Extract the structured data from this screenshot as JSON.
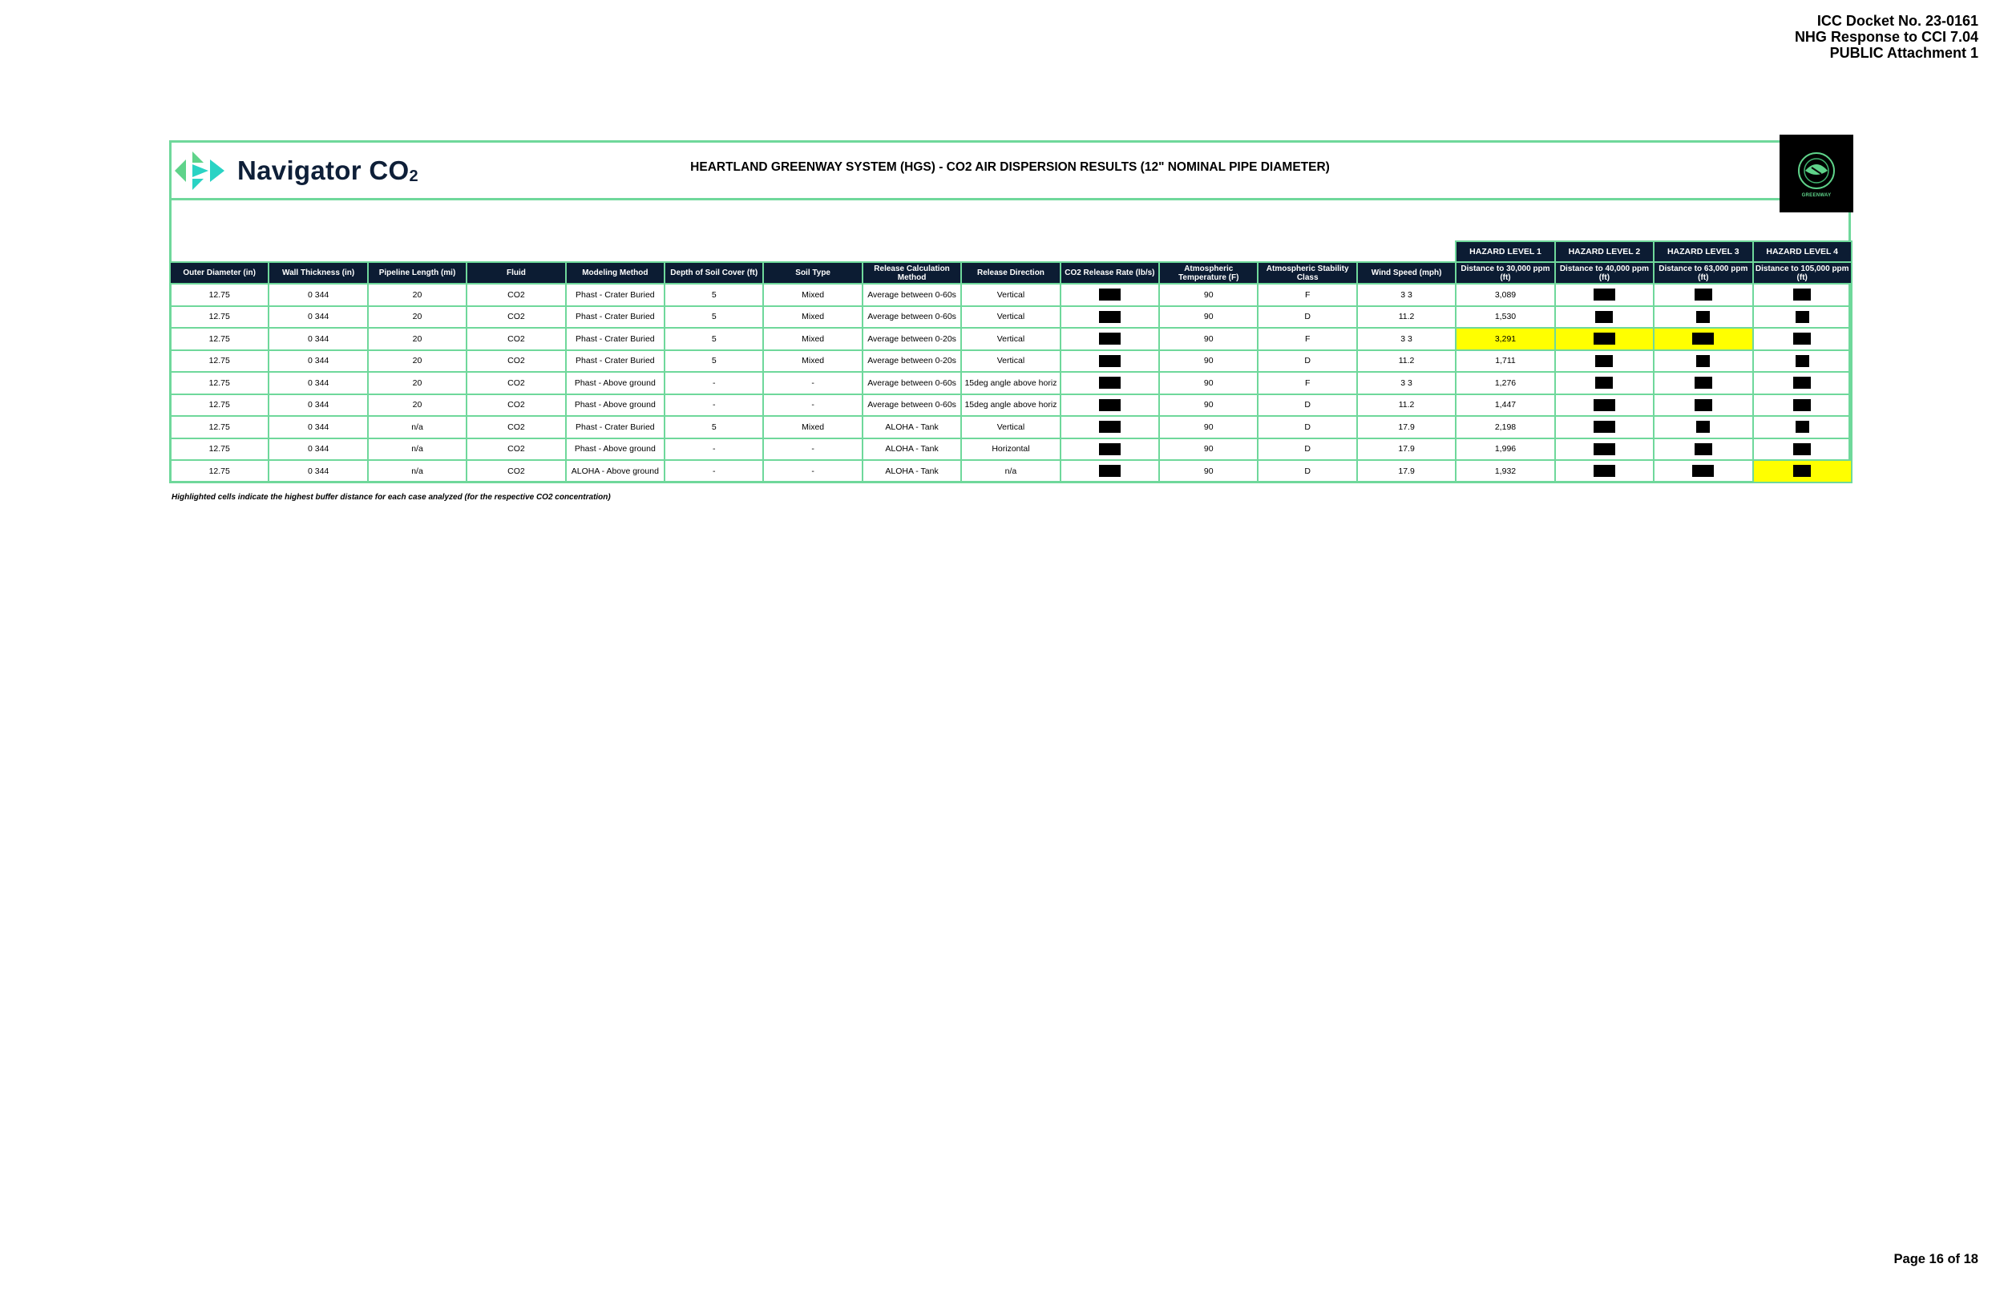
{
  "header": {
    "docket": "ICC Docket No. 23-0161",
    "response": "NHG Response to CCI 7.04",
    "attachment": "PUBLIC Attachment 1"
  },
  "logo": {
    "brand": "Navigator CO",
    "subscript": "2",
    "icon": "navigator-chevrons-icon"
  },
  "corner_logo": {
    "icon": "heartland-greenway-globe-icon",
    "text": "GREENWAY"
  },
  "title": "HEARTLAND GREENWAY SYSTEM (HGS) - CO2 AIR DISPERSION RESULTS (12\" NOMINAL PIPE DIAMETER)",
  "hazard_levels": [
    "HAZARD LEVEL 1",
    "HAZARD LEVEL 2",
    "HAZARD LEVEL 3",
    "HAZARD LEVEL 4"
  ],
  "columns": [
    "Outer Diameter (in)",
    "Wall Thickness (in)",
    "Pipeline Length (mi)",
    "Fluid",
    "Modeling Method",
    "Depth of Soil Cover (ft)",
    "Soil Type",
    "Release Calculation Method",
    "Release Direction",
    "CO2 Release Rate (lb/s)",
    "Atmospheric Temperature (F)",
    "Atmospheric Stability Class",
    "Wind Speed (mph)",
    "Distance to 30,000 ppm (ft)",
    "Distance to 40,000 ppm (ft)",
    "Distance to 63,000 ppm (ft)",
    "Distance to 105,000 ppm (ft)"
  ],
  "rows": [
    {
      "od": "12.75",
      "wt": "0 344",
      "len": "20",
      "fluid": "CO2",
      "method": "Phast - Crater Buried",
      "depth": "5",
      "soil": "Mixed",
      "calc": "Average between 0-60s",
      "dir": "Vertical",
      "temp": "90",
      "stab": "F",
      "wind": "3 3",
      "d30": "3,089",
      "r": [
        "wide",
        "wide",
        "mid",
        "mid"
      ],
      "hl": [
        false,
        false,
        false,
        false
      ]
    },
    {
      "od": "12.75",
      "wt": "0 344",
      "len": "20",
      "fluid": "CO2",
      "method": "Phast - Crater Buried",
      "depth": "5",
      "soil": "Mixed",
      "calc": "Average between 0-60s",
      "dir": "Vertical",
      "temp": "90",
      "stab": "D",
      "wind": "11.2",
      "d30": "1,530",
      "r": [
        "wide",
        "mid",
        "sm",
        "sm"
      ],
      "hl": [
        false,
        false,
        false,
        false
      ]
    },
    {
      "od": "12.75",
      "wt": "0 344",
      "len": "20",
      "fluid": "CO2",
      "method": "Phast - Crater Buried",
      "depth": "5",
      "soil": "Mixed",
      "calc": "Average between 0-20s",
      "dir": "Vertical",
      "temp": "90",
      "stab": "F",
      "wind": "3 3",
      "d30": "3,291",
      "r": [
        "wide",
        "wide",
        "wide",
        "mid"
      ],
      "hl": [
        true,
        true,
        true,
        false
      ]
    },
    {
      "od": "12.75",
      "wt": "0 344",
      "len": "20",
      "fluid": "CO2",
      "method": "Phast - Crater Buried",
      "depth": "5",
      "soil": "Mixed",
      "calc": "Average between 0-20s",
      "dir": "Vertical",
      "temp": "90",
      "stab": "D",
      "wind": "11.2",
      "d30": "1,711",
      "r": [
        "wide",
        "mid",
        "sm",
        "sm"
      ],
      "hl": [
        false,
        false,
        false,
        false
      ]
    },
    {
      "od": "12.75",
      "wt": "0 344",
      "len": "20",
      "fluid": "CO2",
      "method": "Phast - Above ground",
      "depth": "-",
      "soil": "-",
      "calc": "Average between 0-60s",
      "dir": "15deg angle above horiz",
      "temp": "90",
      "stab": "F",
      "wind": "3 3",
      "d30": "1,276",
      "r": [
        "wide",
        "mid",
        "mid",
        "mid"
      ],
      "hl": [
        false,
        false,
        false,
        false
      ]
    },
    {
      "od": "12.75",
      "wt": "0 344",
      "len": "20",
      "fluid": "CO2",
      "method": "Phast - Above ground",
      "depth": "-",
      "soil": "-",
      "calc": "Average between 0-60s",
      "dir": "15deg angle above horiz",
      "temp": "90",
      "stab": "D",
      "wind": "11.2",
      "d30": "1,447",
      "r": [
        "wide",
        "wide",
        "mid",
        "mid"
      ],
      "hl": [
        false,
        false,
        false,
        false
      ]
    },
    {
      "od": "12.75",
      "wt": "0 344",
      "len": "n/a",
      "fluid": "CO2",
      "method": "Phast - Crater Buried",
      "depth": "5",
      "soil": "Mixed",
      "calc": "ALOHA - Tank",
      "dir": "Vertical",
      "temp": "90",
      "stab": "D",
      "wind": "17.9",
      "d30": "2,198",
      "r": [
        "wide",
        "wide",
        "sm",
        "sm"
      ],
      "hl": [
        false,
        false,
        false,
        false
      ]
    },
    {
      "od": "12.75",
      "wt": "0 344",
      "len": "n/a",
      "fluid": "CO2",
      "method": "Phast - Above ground",
      "depth": "-",
      "soil": "-",
      "calc": "ALOHA - Tank",
      "dir": "Horizontal",
      "temp": "90",
      "stab": "D",
      "wind": "17.9",
      "d30": "1,996",
      "r": [
        "wide",
        "wide",
        "mid",
        "mid"
      ],
      "hl": [
        false,
        false,
        false,
        false
      ]
    },
    {
      "od": "12.75",
      "wt": "0 344",
      "len": "n/a",
      "fluid": "CO2",
      "method": "ALOHA - Above ground",
      "depth": "-",
      "soil": "-",
      "calc": "ALOHA - Tank",
      "dir": "n/a",
      "temp": "90",
      "stab": "D",
      "wind": "17.9",
      "d30": "1,932",
      "r": [
        "wide",
        "wide",
        "wide",
        "mid"
      ],
      "hl": [
        false,
        false,
        false,
        true
      ]
    }
  ],
  "footnote": "Highlighted cells indicate the highest buffer distance for each case analyzed (for the respective CO2 concentration)",
  "page": "Page 16 of 18",
  "colors": {
    "header_bg": "#0c1c33",
    "border": "#6fd89b",
    "highlight": "#ffff00",
    "logo_green": "#5fd38a",
    "logo_teal": "#29d3c4"
  }
}
